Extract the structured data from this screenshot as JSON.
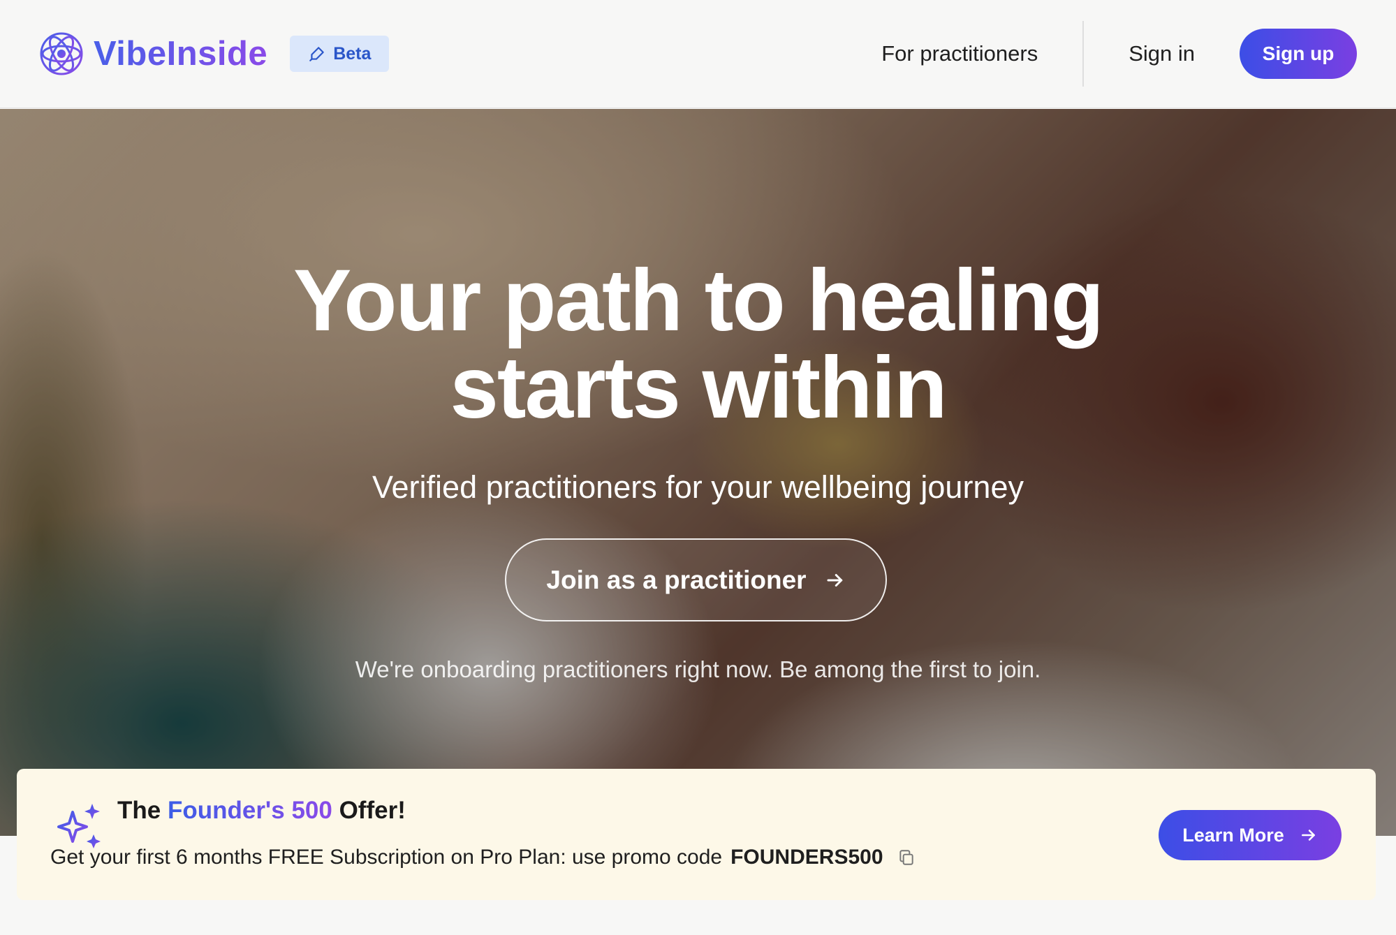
{
  "header": {
    "logo_text": "VibeInside",
    "logo_icon": "atom-logo-icon",
    "beta_label": "Beta",
    "beta_icon": "pen-icon",
    "nav": {
      "practitioners_label": "For practitioners",
      "signin_label": "Sign in",
      "signup_label": "Sign up"
    }
  },
  "hero": {
    "title_line1": "Your path to healing",
    "title_line2": "starts within",
    "subtitle": "Verified practitioners for your wellbeing journey",
    "cta_label": "Join as a practitioner",
    "cta_icon": "arrow-right-icon",
    "note": "We're onboarding practitioners right now. Be among the first to join."
  },
  "offer": {
    "icon": "sparkles-icon",
    "title_prefix": "The ",
    "title_highlight": "Founder's 500",
    "title_suffix": " Offer!",
    "description": "Get your first 6 months FREE Subscription on Pro Plan: use promo code",
    "promo_code": "FOUNDERS500",
    "copy_icon": "copy-icon",
    "button_label": "Learn More",
    "button_icon": "arrow-right-icon"
  },
  "colors": {
    "accent_start": "#3c4ee6",
    "accent_end": "#7a3fe2",
    "beta_bg": "#dbe7fb",
    "offer_bg": "#fdf8e8"
  }
}
